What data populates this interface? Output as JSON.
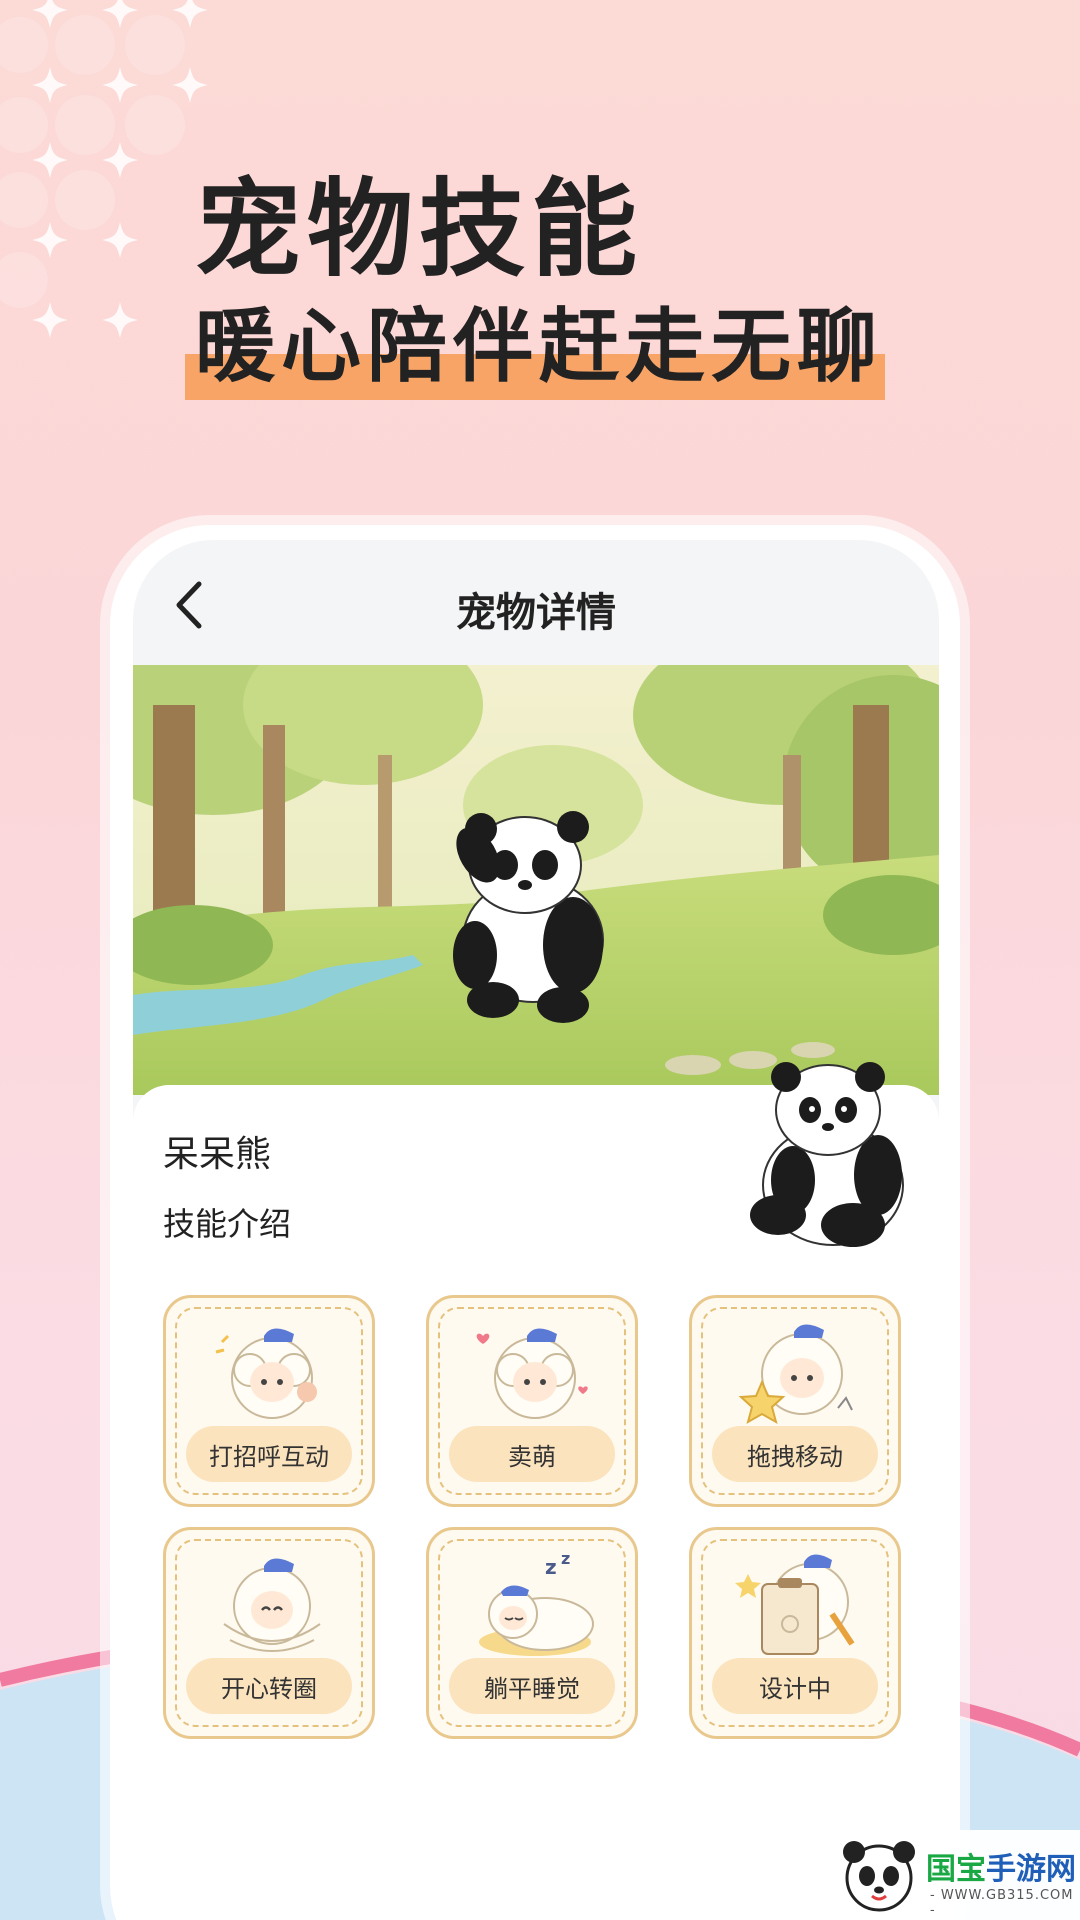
{
  "promo": {
    "title": "宠物技能",
    "subtitle": "暖心陪伴赶走无聊"
  },
  "app": {
    "nav_title": "宠物详情",
    "back_icon": "chevron-left-icon"
  },
  "pet": {
    "name": "呆呆熊",
    "skills_heading": "技能介绍"
  },
  "skills": [
    {
      "label": "打招呼互动",
      "icon": "sheep-wave-icon"
    },
    {
      "label": "卖萌",
      "icon": "sheep-cute-icon"
    },
    {
      "label": "拖拽移动",
      "icon": "sheep-drag-icon"
    },
    {
      "label": "开心转圈",
      "icon": "sheep-spin-icon"
    },
    {
      "label": "躺平睡觉",
      "icon": "sheep-sleep-icon"
    },
    {
      "label": "设计中",
      "icon": "sheep-design-icon"
    }
  ],
  "watermark": {
    "brand_part1": "国宝",
    "brand_part2": "手游网",
    "url": "- WWW.GB315.COM -"
  },
  "colors": {
    "accent_bar": "#f7a466",
    "skill_border": "#e9c88d",
    "skill_pill": "#fbe3bd"
  }
}
